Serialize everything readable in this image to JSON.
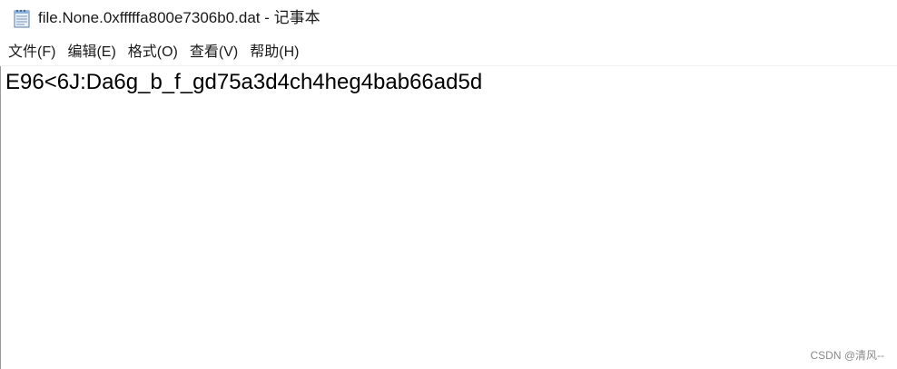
{
  "window": {
    "title": "file.None.0xfffffa800e7306b0.dat - 记事本",
    "icon": "notepad-icon"
  },
  "menu": {
    "items": [
      {
        "label": "文件(F)"
      },
      {
        "label": "编辑(E)"
      },
      {
        "label": "格式(O)"
      },
      {
        "label": "查看(V)"
      },
      {
        "label": "帮助(H)"
      }
    ]
  },
  "editor": {
    "content": "E96<6J:Da6g_b_f_gd75a3d4ch4heg4bab66ad5d"
  },
  "watermark": {
    "text": "CSDN @清风--"
  }
}
